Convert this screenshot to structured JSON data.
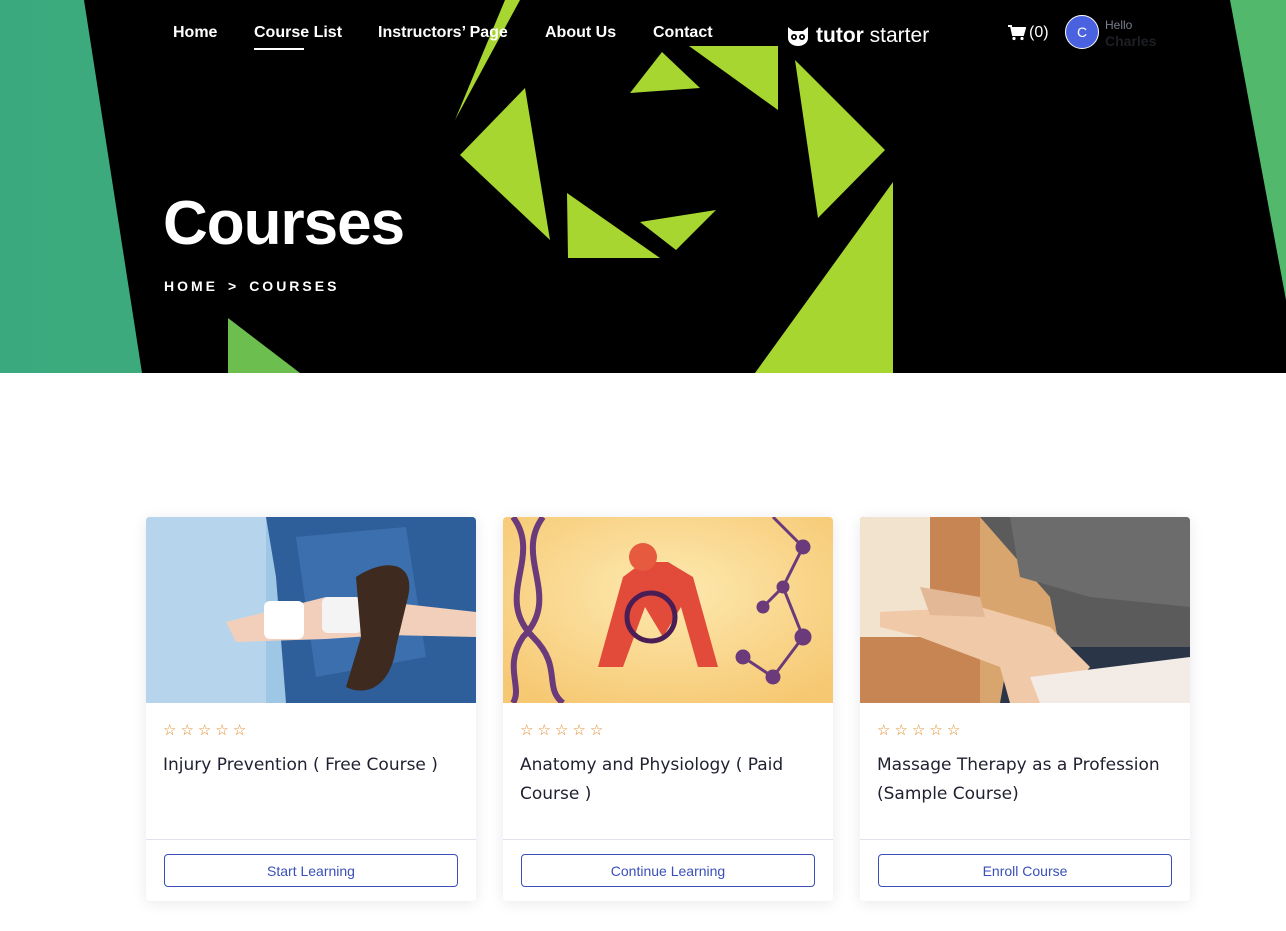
{
  "nav": {
    "links": [
      {
        "label": "Home"
      },
      {
        "label": "Course List"
      },
      {
        "label": "Instructors’ Page"
      },
      {
        "label": "About Us"
      },
      {
        "label": "Contact"
      }
    ],
    "logo_bold": "tutor",
    "logo_light": "starter",
    "cart_count": "(0)",
    "avatar_initial": "C",
    "hello": "Hello",
    "user_name": "Charles"
  },
  "hero": {
    "title": "Courses",
    "breadcrumb": [
      "HOME",
      ">",
      "COURSES"
    ]
  },
  "courses": [
    {
      "title": "Injury Prevention ( Free Course )",
      "button": "Start Learning",
      "rating": 0,
      "max_rating": 5
    },
    {
      "title": "Anatomy and Physiology ( Paid Course )",
      "button": "Continue Learning",
      "rating": 0,
      "max_rating": 5
    },
    {
      "title": "Massage Therapy as a Profession (Sample Course)",
      "button": "Enroll Course",
      "rating": 0,
      "max_rating": 5
    }
  ],
  "colors": {
    "accent": "#3a4fb8",
    "star": "#e08a2b",
    "hero_green": "#3fae80",
    "hero_lime": "#a8d630"
  },
  "icons": [
    "owl-logo-icon",
    "cart-icon",
    "star-outline-icon"
  ]
}
